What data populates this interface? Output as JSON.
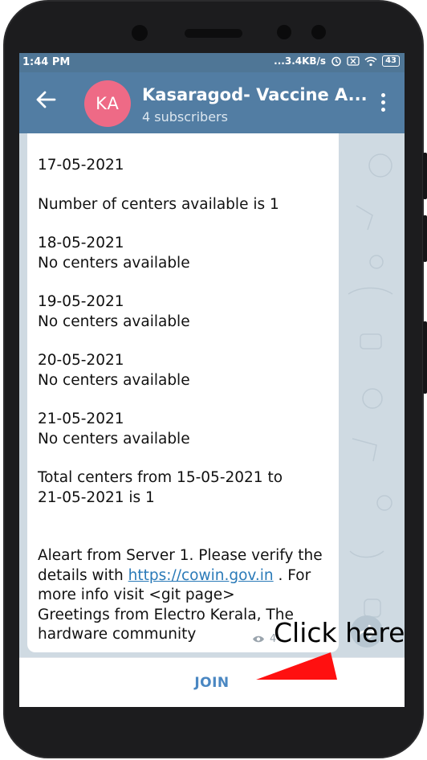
{
  "status_bar": {
    "time": "1:44 PM",
    "network_speed": "...3.4KB/s",
    "battery": "43"
  },
  "channel": {
    "avatar_initials": "KA",
    "title": "Kasaragod- Vaccine A...",
    "subtitle": "4 subscribers"
  },
  "message": {
    "lines": [
      "17-05-2021",
      "Number of centers available is 1",
      "18-05-2021",
      "No centers available",
      "19-05-2021",
      "No centers available",
      "20-05-2021",
      "No centers available",
      "21-05-2021",
      "No centers available",
      "Total centers from 15-05-2021 to",
      "21-05-2021 is 1"
    ],
    "alert_prefix": "Aleart from Server 1. Please verify the details with ",
    "alert_link": "https://cowin.gov.in",
    "alert_suffix": " . For more info visit <git page>",
    "greeting_line1": "Greetings from Electro Kerala, The",
    "greeting_line2": "hardware community",
    "views": "4"
  },
  "join_label": "JOIN",
  "annotation": {
    "text": "Click here",
    "arrow_color": "#ff0000"
  },
  "colors": {
    "header": "#527da3",
    "avatar": "#ee6a86",
    "join": "#4a87c2"
  }
}
